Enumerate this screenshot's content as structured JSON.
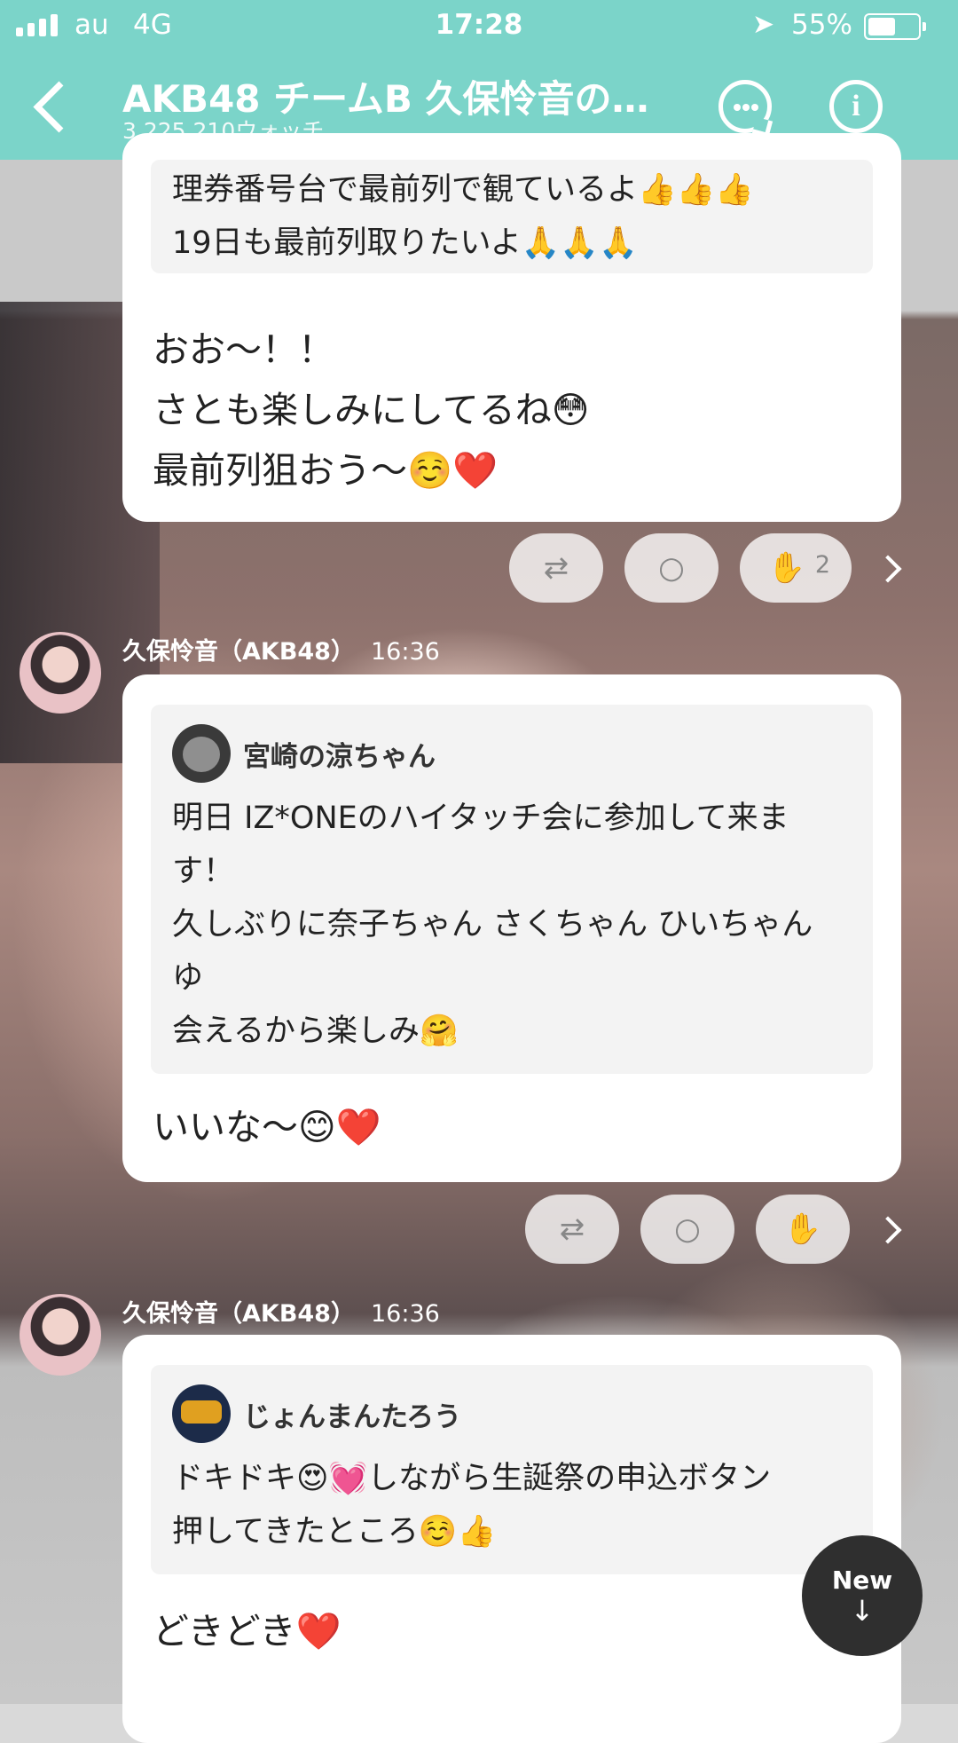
{
  "status_bar": {
    "carrier": "au",
    "network": "4G",
    "time": "17:28",
    "battery": "55%"
  },
  "header": {
    "title": "AKB48 チームB 久保怜音の…",
    "subtitle": "3,225,210ウォッチ"
  },
  "messages": [
    {
      "quote_lines": [
        "理券番号台で最前列で観ているよ👍👍👍",
        "19日も最前列取りたいよ🙏🙏🙏"
      ],
      "reply_lines": [
        "おお〜！！",
        "さとも楽しみにしてるね😳",
        "最前列狙おう〜☺️❤️"
      ],
      "clap_count": "2"
    },
    {
      "sender": "久保怜音（AKB48）",
      "time": "16:36",
      "quote_author": "宮崎の涼ちゃん",
      "quote_lines": [
        "明日 IZ*ONEのハイタッチ会に参加して来ま",
        "す！",
        "久しぶりに奈子ちゃん さくちゃん ひいちゃん",
        "ゆ",
        "会えるから楽しみ🤗"
      ],
      "reply_lines": [
        "いいな〜😊❤️"
      ]
    },
    {
      "sender": "久保怜音（AKB48）",
      "time": "16:36",
      "quote_author": "じょんまんたろう",
      "quote_lines": [
        "ドキドキ😍💓しながら生誕祭の申込ボタン",
        "押してきたところ☺️👍"
      ],
      "reply_lines": [
        "どきどき❤️"
      ]
    }
  ],
  "new_button": {
    "label": "New",
    "arrow": "↓"
  },
  "icons": [
    "back-icon",
    "chat-icon",
    "info-icon",
    "retweet-icon",
    "comment-icon",
    "clap-icon",
    "chevron-right-icon",
    "arrow-down-icon"
  ]
}
